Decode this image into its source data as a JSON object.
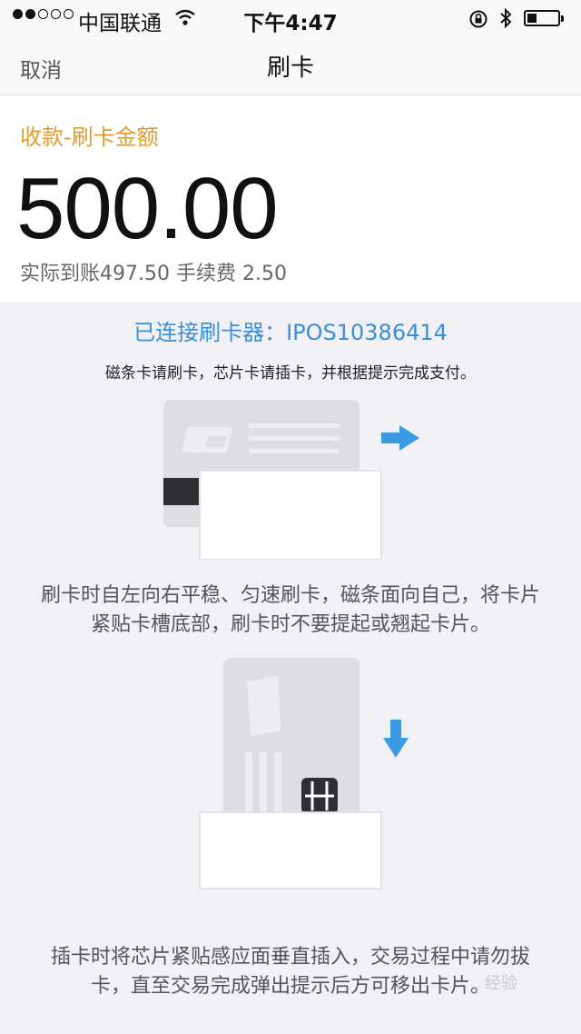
{
  "status_bar": {
    "carrier": "中国联通",
    "time": "下午4:47",
    "battery_level": 0.3
  },
  "nav": {
    "cancel_label": "取消",
    "title": "刷卡"
  },
  "amount": {
    "label": "收款-刷卡金额",
    "value": "500.00",
    "detail": "实际到账497.50 手续费 2.50"
  },
  "instructions": {
    "connected_text": "已连接刷卡器：IPOS10386414",
    "tip": "磁条卡请刷卡，芯片卡请插卡，并根据提示完成支付。",
    "swipe_lines": [
      "刷卡时自左向右平稳、匀速刷卡，磁条面向自己，将卡片",
      "紧贴卡槽底部，刷卡时不要提起或翘起卡片。"
    ],
    "insert_lines": [
      "插卡时将芯片紧贴感应面垂直插入，交易过程中请勿拔",
      "卡，直至交易完成弹出提示后方可移出卡片。"
    ]
  },
  "colors": {
    "accent_blue": "#3b8ed8",
    "label_orange": "#e29a2c"
  },
  "icons": {
    "right_arrow": "right-arrow-icon",
    "down_arrow": "down-arrow-icon"
  },
  "watermark": "经验"
}
